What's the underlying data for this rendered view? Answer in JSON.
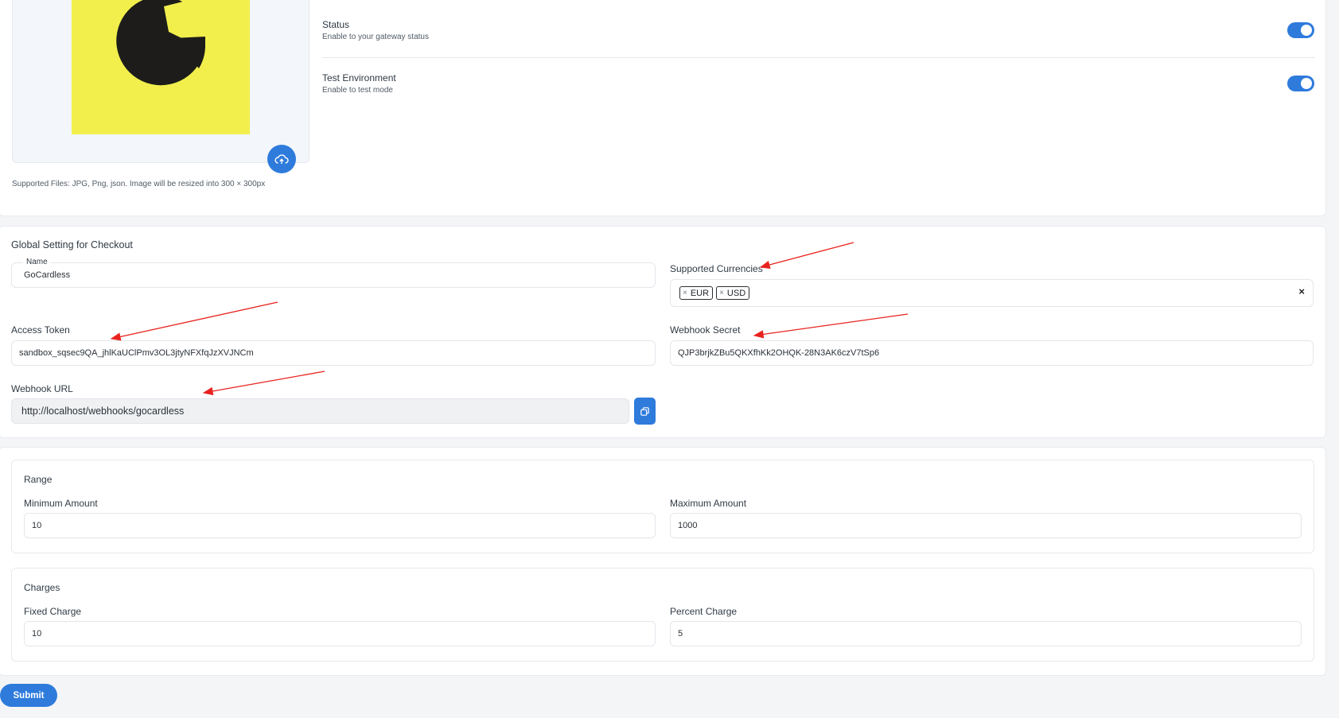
{
  "logo": {
    "supported_files": "Supported Files: JPG, Png, json. Image will be resized into 300 × 300px"
  },
  "settings": {
    "status": {
      "label": "Status",
      "description": "Enable to your gateway status",
      "enabled": true
    },
    "test_env": {
      "label": "Test Environment",
      "description": "Enable to test mode",
      "enabled": true
    }
  },
  "checkout": {
    "title": "Global Setting for Checkout",
    "name_label": "Name",
    "name_value": "GoCardless",
    "currencies_label": "Supported Currencies",
    "currencies": [
      "EUR",
      "USD"
    ],
    "access_token_label": "Access Token",
    "access_token_value": "sandbox_sqsec9QA_jhlKaUClPmv3OL3jtyNFXfqJzXVJNCm",
    "webhook_secret_label": "Webhook Secret",
    "webhook_secret_value": "QJP3brjkZBu5QKXfhKk2OHQK-28N3AK6czV7tSp6",
    "webhook_url_label": "Webhook URL",
    "webhook_url_value": "http://localhost/webhooks/gocardless"
  },
  "range": {
    "title": "Range",
    "min_label": "Minimum Amount",
    "min_value": "10",
    "max_label": "Maximum Amount",
    "max_value": "1000"
  },
  "charges": {
    "title": "Charges",
    "fixed_label": "Fixed Charge",
    "fixed_value": "10",
    "percent_label": "Percent Charge",
    "percent_value": "5"
  },
  "submit_label": "Submit",
  "colors": {
    "accent": "#2e7bdc",
    "logo_bg": "#f2ef4d",
    "annotation": "#e8231f"
  }
}
